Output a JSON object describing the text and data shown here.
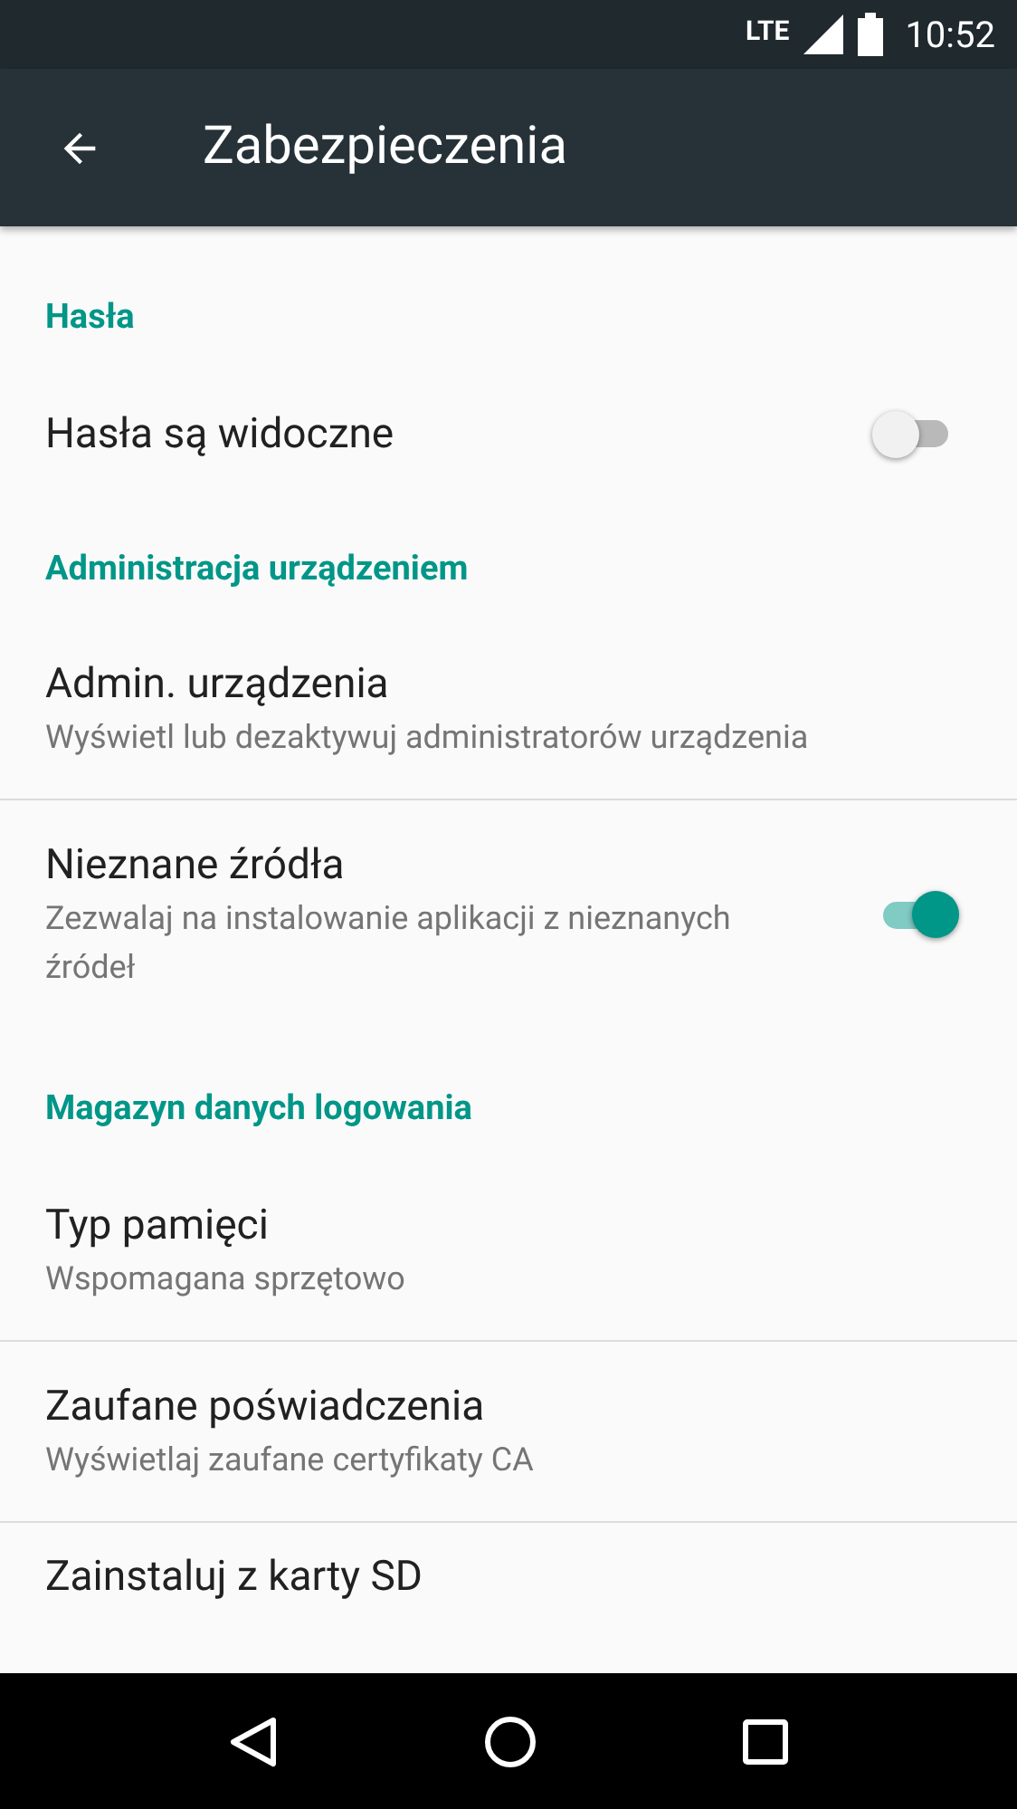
{
  "status_bar": {
    "network": "LTE",
    "time": "10:52"
  },
  "toolbar": {
    "title": "Zabezpieczenia"
  },
  "items": [
    {
      "kind": "header",
      "title": "Hasła"
    },
    {
      "kind": "switch",
      "title": "Hasła są widoczne",
      "on": false,
      "divider": false
    },
    {
      "kind": "header",
      "title": "Administracja urządzeniem"
    },
    {
      "kind": "item",
      "title": "Admin. urządzenia",
      "subtitle": "Wyświetl lub dezaktywuj administratorów urządzenia",
      "divider": true
    },
    {
      "kind": "switch",
      "title": "Nieznane źródła",
      "subtitle": "Zezwalaj na instalowanie aplikacji z nieznanych źródeł",
      "on": true,
      "divider": false
    },
    {
      "kind": "header",
      "title": "Magazyn danych logowania"
    },
    {
      "kind": "item",
      "title": "Typ pamięci",
      "subtitle": "Wspomagana sprzętowo",
      "divider": true
    },
    {
      "kind": "item",
      "title": "Zaufane poświadczenia",
      "subtitle": "Wyświetlaj zaufane certyfikaty CA",
      "divider": true
    },
    {
      "kind": "item",
      "title": "Zainstaluj z karty SD",
      "divider": false
    }
  ]
}
